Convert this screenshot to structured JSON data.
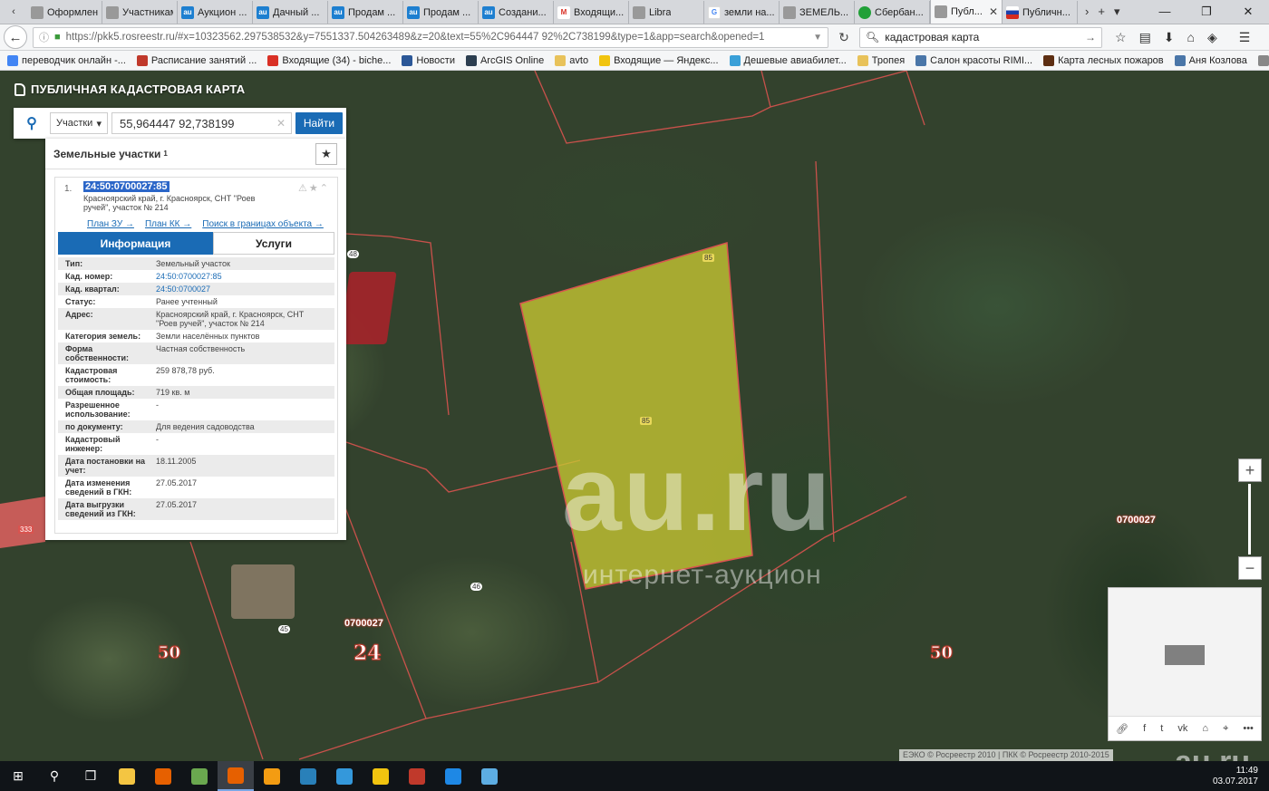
{
  "browser": {
    "tabs": [
      {
        "label": "Оформлени...",
        "icon": "document-icon"
      },
      {
        "label": "Участникам |...",
        "icon": "document-icon"
      },
      {
        "label": "Аукцион ...",
        "icon": "au-icon"
      },
      {
        "label": "Дачный ...",
        "icon": "au-icon"
      },
      {
        "label": "Продам ...",
        "icon": "au-icon"
      },
      {
        "label": "Продам ...",
        "icon": "au-icon"
      },
      {
        "label": "Создани...",
        "icon": "au-icon"
      },
      {
        "label": "Входящи...",
        "icon": "gmail-icon"
      },
      {
        "label": "Libra",
        "icon": "libra-icon"
      },
      {
        "label": "земли на...",
        "icon": "google-icon"
      },
      {
        "label": "ЗЕМЕЛЬ...",
        "icon": "document-icon"
      },
      {
        "label": "Сбербан...",
        "icon": "sberbank-icon"
      },
      {
        "label": "Публ...",
        "icon": "pkk-icon",
        "active": true
      },
      {
        "label": "Публичн...",
        "icon": "russia-flag-icon"
      }
    ],
    "url": "https://pkk5.rosreestr.ru/#x=10323562.297538532&y=7551337.504263489&z=20&text=55%2C964447 92%2C738199&type=1&app=search&opened=1",
    "search_query": "кадастровая карта",
    "bookmarks": [
      {
        "label": "переводчик онлайн -...",
        "color": "#4285f4"
      },
      {
        "label": "Расписание занятий ...",
        "color": "#c0392b"
      },
      {
        "label": "Входящие (34) - biche...",
        "color": "#d93025"
      },
      {
        "label": "Новости",
        "color": "#2b5797"
      },
      {
        "label": "ArcGIS Online",
        "color": "#2c3e50"
      },
      {
        "label": "avto",
        "color": "#e8c25a"
      },
      {
        "label": "Входящие — Яндекс...",
        "color": "#f1c40f"
      },
      {
        "label": "Дешевые авиабилет...",
        "color": "#3aa0d8"
      },
      {
        "label": "Тропея",
        "color": "#e8c25a"
      },
      {
        "label": "Салон красоты RIMI...",
        "color": "#4a76a8"
      },
      {
        "label": "Карта лесных пожаров",
        "color": "#5d2e12"
      },
      {
        "label": "Аня Козлова",
        "color": "#4a76a8"
      },
      {
        "label": "Обучение | GeekBrain...",
        "color": "#888888"
      }
    ]
  },
  "app": {
    "title": "ПУБЛИЧНАЯ КАДАСТРОВАЯ КАРТА",
    "search": {
      "type": "Участки",
      "value": "55,964447 92,738199",
      "find_label": "Найти"
    },
    "results": {
      "title": "Земельные участки",
      "count": "1",
      "item": {
        "index": "1.",
        "cad_number": "24:50:0700027:85",
        "address": "Красноярский край, г. Красноярск, СНТ \"Роев ручей\", участок № 214",
        "links": [
          "План ЗУ →",
          "План КК →",
          "Поиск в границах объекта →"
        ],
        "tab_info": "Информация",
        "tab_services": "Услуги",
        "props": [
          {
            "k": "Тип:",
            "v": "Земельный участок"
          },
          {
            "k": "Кад. номер:",
            "v": "24:50:0700027:85",
            "link": true
          },
          {
            "k": "Кад. квартал:",
            "v": "24:50:0700027",
            "link": true
          },
          {
            "k": "Статус:",
            "v": "Ранее учтенный"
          },
          {
            "k": "Адрес:",
            "v": "Красноярский край, г. Красноярск, СНТ \"Роев ручей\", участок № 214"
          },
          {
            "k": "Категория земель:",
            "v": "Земли населённых пунктов"
          },
          {
            "k": "Форма собственности:",
            "v": "Частная собственность"
          },
          {
            "k": "Кадастровая стоимость:",
            "v": "259 878,78 руб."
          },
          {
            "k": "Общая площадь:",
            "v": "719 кв. м"
          },
          {
            "k": "Разрешенное использование:",
            "v": "-"
          },
          {
            "k": "по документу:",
            "v": "Для ведения садоводства"
          },
          {
            "k": "Кадастровый инженер:",
            "v": "-"
          },
          {
            "k": "Дата постановки на учет:",
            "v": "18.11.2005"
          },
          {
            "k": "Дата изменения сведений в ГКН:",
            "v": "27.05.2017"
          },
          {
            "k": "Дата выгрузки сведений из ГКН:",
            "v": "27.05.2017"
          }
        ]
      }
    },
    "map_labels": {
      "n50_left": "50",
      "n24": "24",
      "n50_right": "50",
      "quarter_left": "0700027",
      "quarter_right": "0700027",
      "plot_top": "85",
      "plot_center": "85",
      "tag_48": "48",
      "tag_46": "46",
      "tag_45": "45",
      "tag_333": "333"
    },
    "watermark": {
      "big": "au.ru",
      "small": "интернет-аукцион"
    },
    "copyright": "ЕЭКО © Росреестр 2010 | ПКК © Росреестр 2010-2015"
  },
  "taskbar": {
    "time": "11:49",
    "date": "03.07.2017",
    "apps": [
      {
        "name": "file-explorer",
        "color": "#f4c542"
      },
      {
        "name": "firefox",
        "color": "#e66000"
      },
      {
        "name": "photo-app",
        "color": "#6aa84f"
      },
      {
        "name": "firefox-active",
        "color": "#e66000",
        "active": true
      },
      {
        "name": "fire-app",
        "color": "#f39c12"
      },
      {
        "name": "globe-app",
        "color": "#2980b9"
      },
      {
        "name": "search-app",
        "color": "#3498db"
      },
      {
        "name": "1c-app",
        "color": "#f1c40f"
      },
      {
        "name": "chart-app",
        "color": "#c0392b"
      },
      {
        "name": "edge",
        "color": "#1e88e5"
      },
      {
        "name": "tool-app",
        "color": "#5dade2"
      }
    ]
  },
  "colors": {
    "accent": "#1a6bb5",
    "plot_fill": "#c8c832",
    "boundary": "#d9534f"
  }
}
